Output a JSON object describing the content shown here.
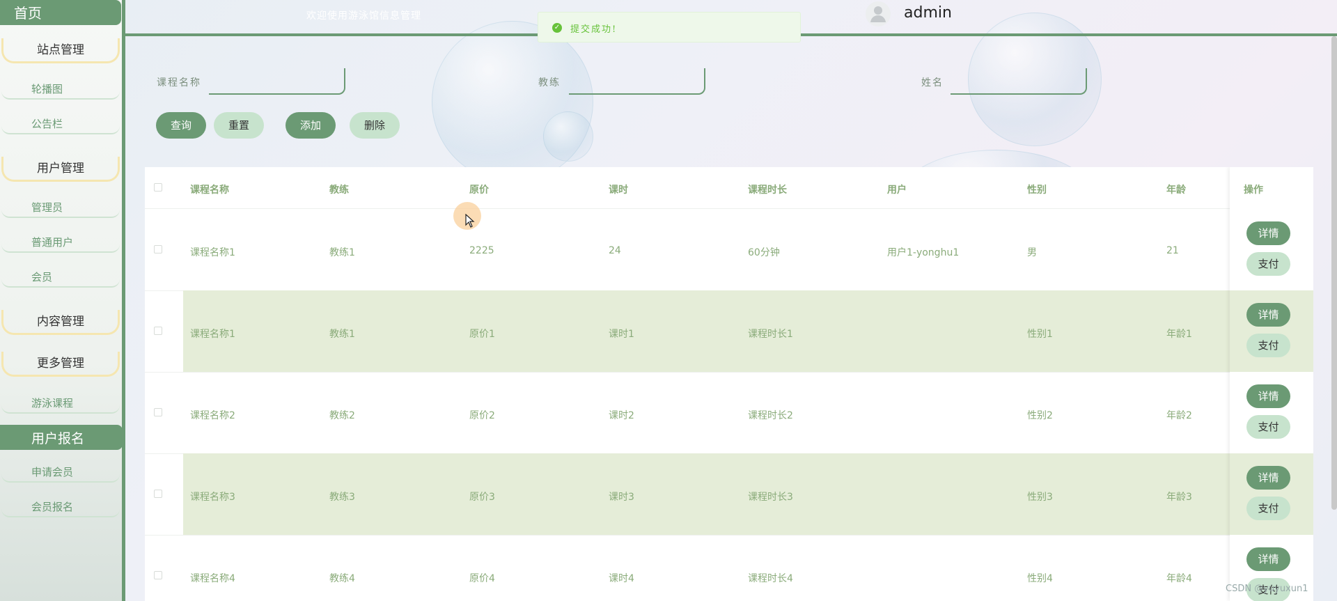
{
  "sidebar": {
    "home": "首页",
    "groups": [
      {
        "label": "站点管理",
        "items": [
          "轮播图",
          "公告栏"
        ]
      },
      {
        "label": "用户管理",
        "items": [
          "管理员",
          "普通用户",
          "会员"
        ]
      },
      {
        "label": "内容管理",
        "items": []
      },
      {
        "label": "更多管理",
        "items": [
          "游泳课程"
        ]
      }
    ],
    "section": "用户报名",
    "section_items": [
      "申请会员",
      "会员报名"
    ]
  },
  "header": {
    "welcome": "欢迎使用游泳馆信息管理",
    "username": "admin",
    "avatar_icon": "user-avatar-icon"
  },
  "toast": {
    "message": "提交成功!",
    "icon": "check-circle-icon",
    "color": "#67c23a"
  },
  "search": {
    "fields": [
      {
        "label": "课程名称",
        "value": "",
        "placeholder": ""
      },
      {
        "label": "教练",
        "value": "",
        "placeholder": ""
      },
      {
        "label": "姓名",
        "value": "",
        "placeholder": ""
      }
    ],
    "buttons": {
      "query": "查询",
      "reset": "重置",
      "add": "添加",
      "delete": "删除"
    }
  },
  "table": {
    "columns": [
      "课程名称",
      "教练",
      "原价",
      "课时",
      "课程时长",
      "用户",
      "性别",
      "年龄"
    ],
    "ops_title": "操作",
    "rows": [
      [
        "课程名称1",
        "教练1",
        "2225",
        "24",
        "60分钟",
        "用户1-yonghu1",
        "男",
        "21"
      ],
      [
        "课程名称1",
        "教练1",
        "原价1",
        "课时1",
        "课程时长1",
        "",
        "性别1",
        "年龄1"
      ],
      [
        "课程名称2",
        "教练2",
        "原价2",
        "课时2",
        "课程时长2",
        "",
        "性别2",
        "年龄2"
      ],
      [
        "课程名称3",
        "教练3",
        "原价3",
        "课时3",
        "课程时长3",
        "",
        "性别3",
        "年龄3"
      ],
      [
        "课程名称4",
        "教练4",
        "原价4",
        "课时4",
        "课程时长4",
        "",
        "性别4",
        "年龄4"
      ]
    ],
    "row_actions": {
      "detail": "详情",
      "pay": "支付"
    }
  },
  "watermark": "CSDN @yuyuxun1",
  "colors": {
    "primary": "#6b9a74",
    "light": "#c7e3cd",
    "alt_row": "#e5edd8",
    "text": "#8aab7a"
  }
}
